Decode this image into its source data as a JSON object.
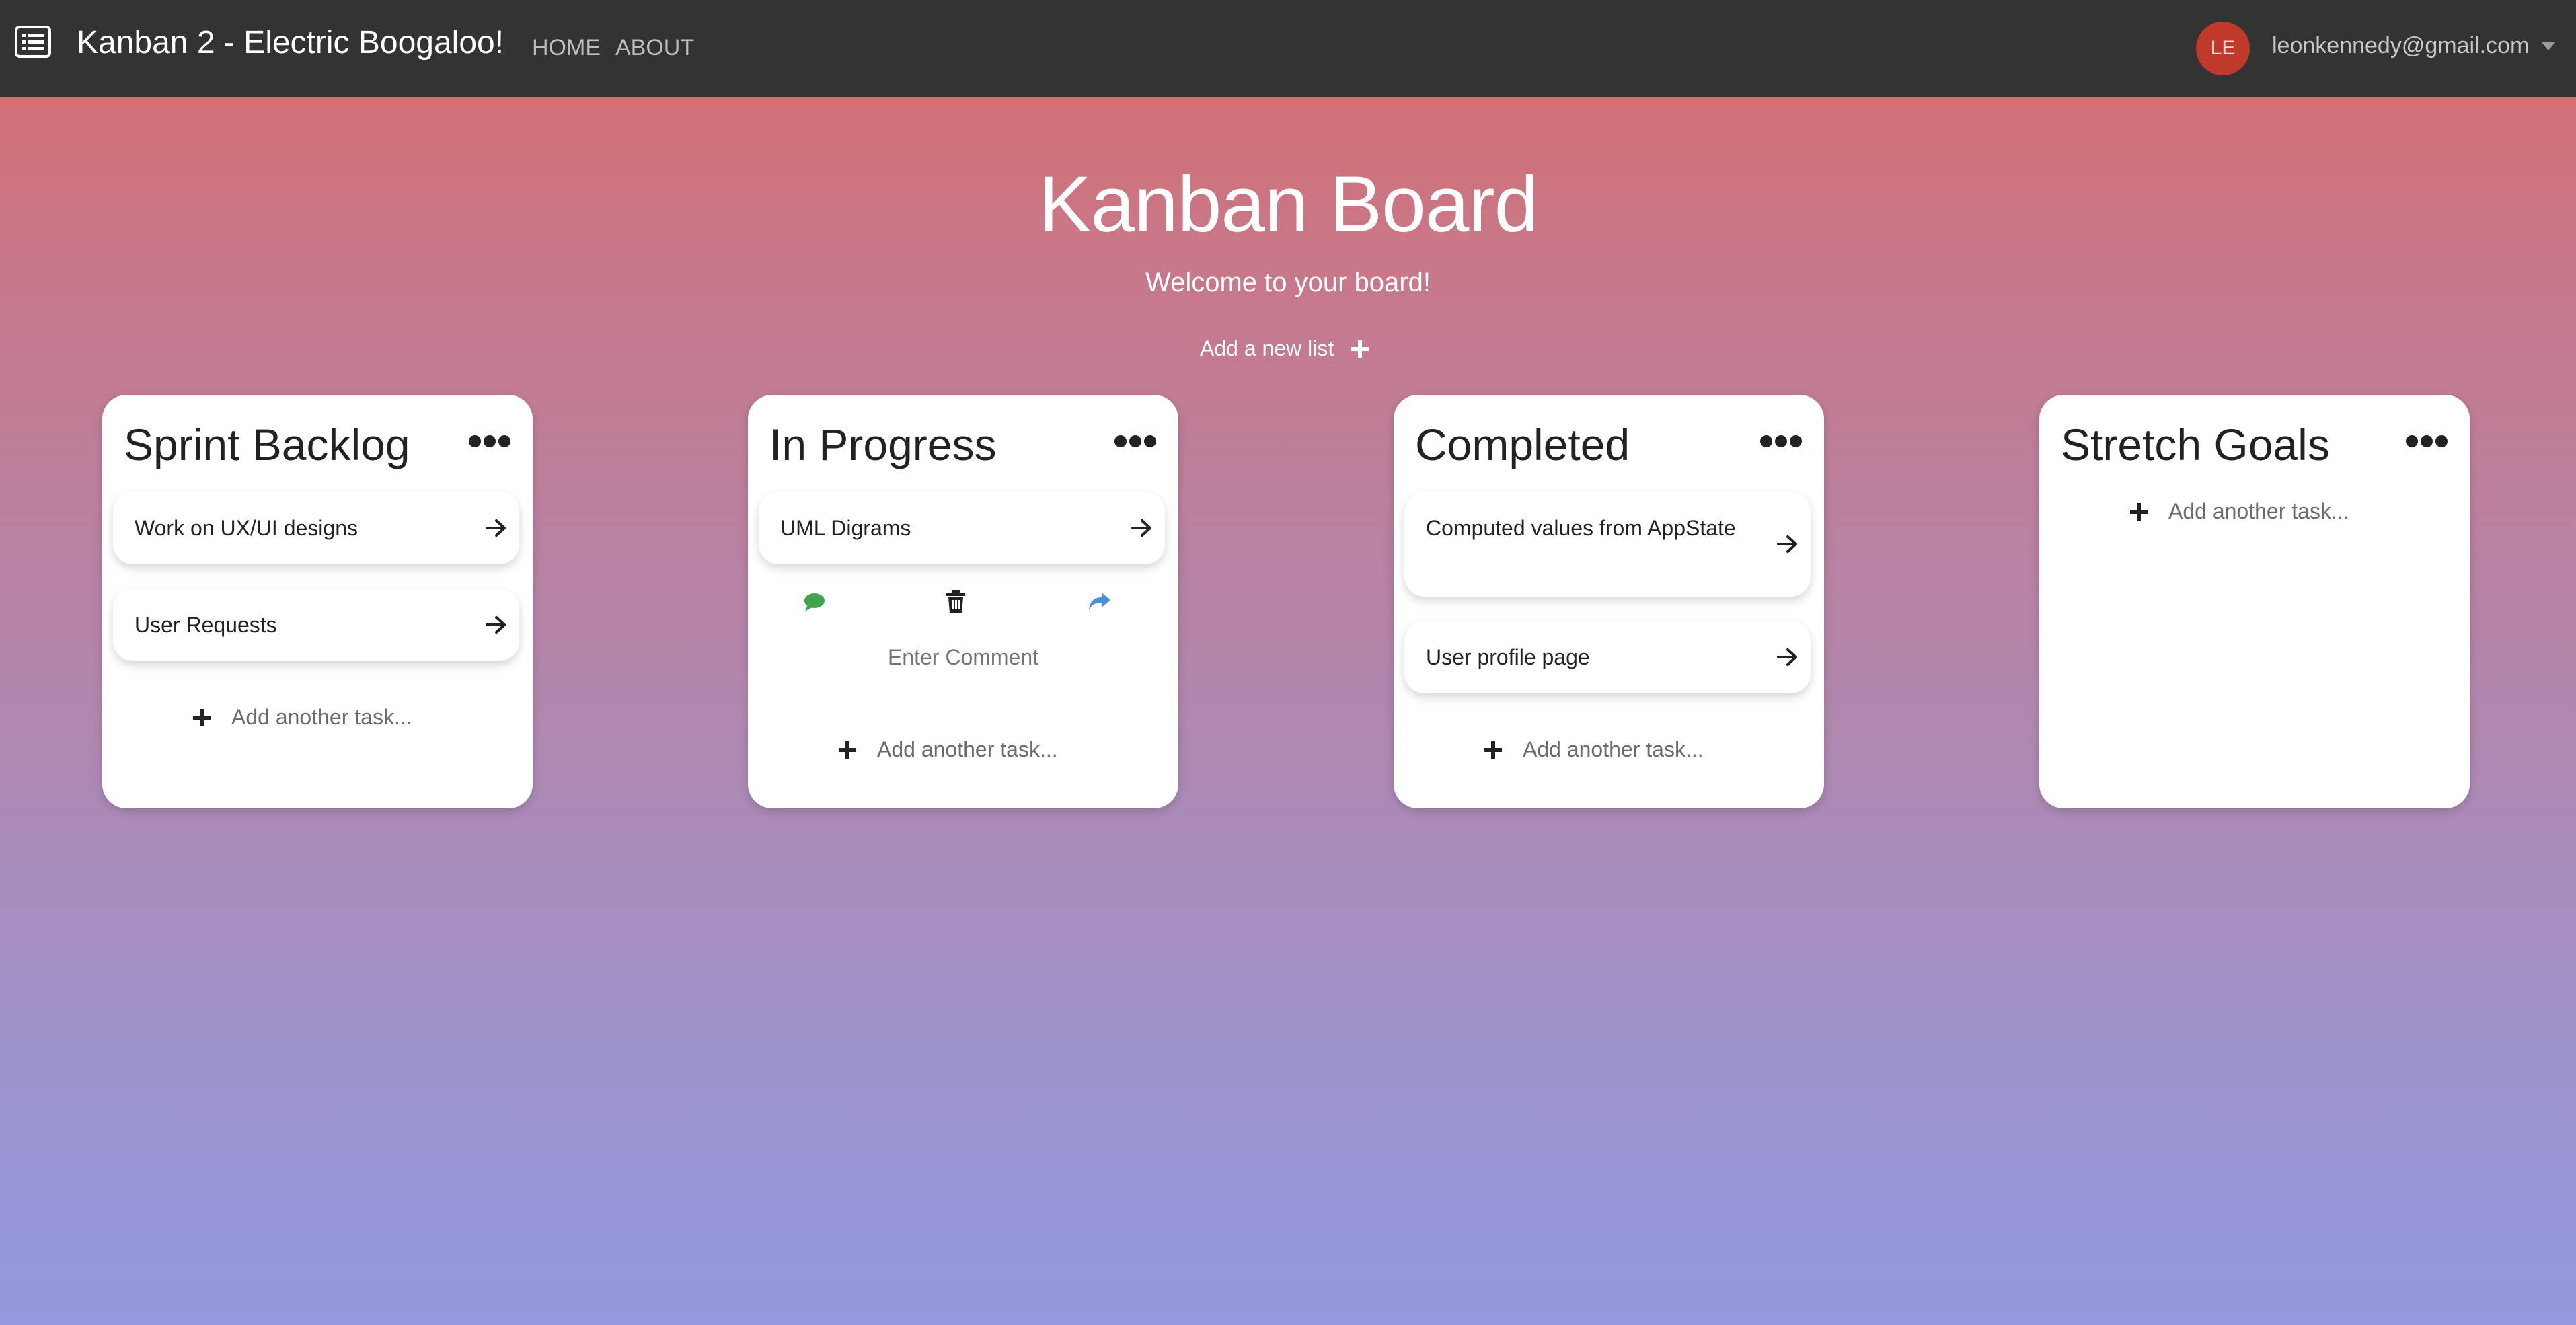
{
  "navbar": {
    "brand": "Kanban 2 - Electric Boogaloo!",
    "links": [
      {
        "label": "HOME"
      },
      {
        "label": "ABOUT"
      }
    ],
    "user": {
      "initials": "LE",
      "email": "leonkennedy@gmail.com"
    }
  },
  "header": {
    "title": "Kanban Board",
    "subtitle": "Welcome to your board!",
    "add_list_label": "Add a new list"
  },
  "lists": [
    {
      "title": "Sprint Backlog",
      "tasks": [
        "Work on UX/UI designs",
        "User Requests"
      ],
      "add_task_label": "Add another task..."
    },
    {
      "title": "In Progress",
      "tasks": [
        "UML Digrams"
      ],
      "comment_placeholder": "Enter Comment",
      "add_task_label": "Add another task..."
    },
    {
      "title": "Completed",
      "tasks": [
        "Computed values from AppState",
        "User profile page"
      ],
      "add_task_label": "Add another task..."
    },
    {
      "title": "Stretch Goals",
      "tasks": [],
      "add_task_label": "Add another task..."
    }
  ],
  "colors": {
    "navbar": "#333333",
    "avatar": "#c0392b",
    "comment_icon": "#3fa34d",
    "share_icon": "#4a8fd8",
    "gradient_top": "#d86b69",
    "gradient_bottom": "#9399dc"
  },
  "icons": {
    "menu": "list-icon",
    "list_options": "ellipsis-icon",
    "task_open": "arrow-right-icon",
    "comment": "comment-icon",
    "delete": "trash-icon",
    "share": "share-icon",
    "add": "plus-icon"
  }
}
